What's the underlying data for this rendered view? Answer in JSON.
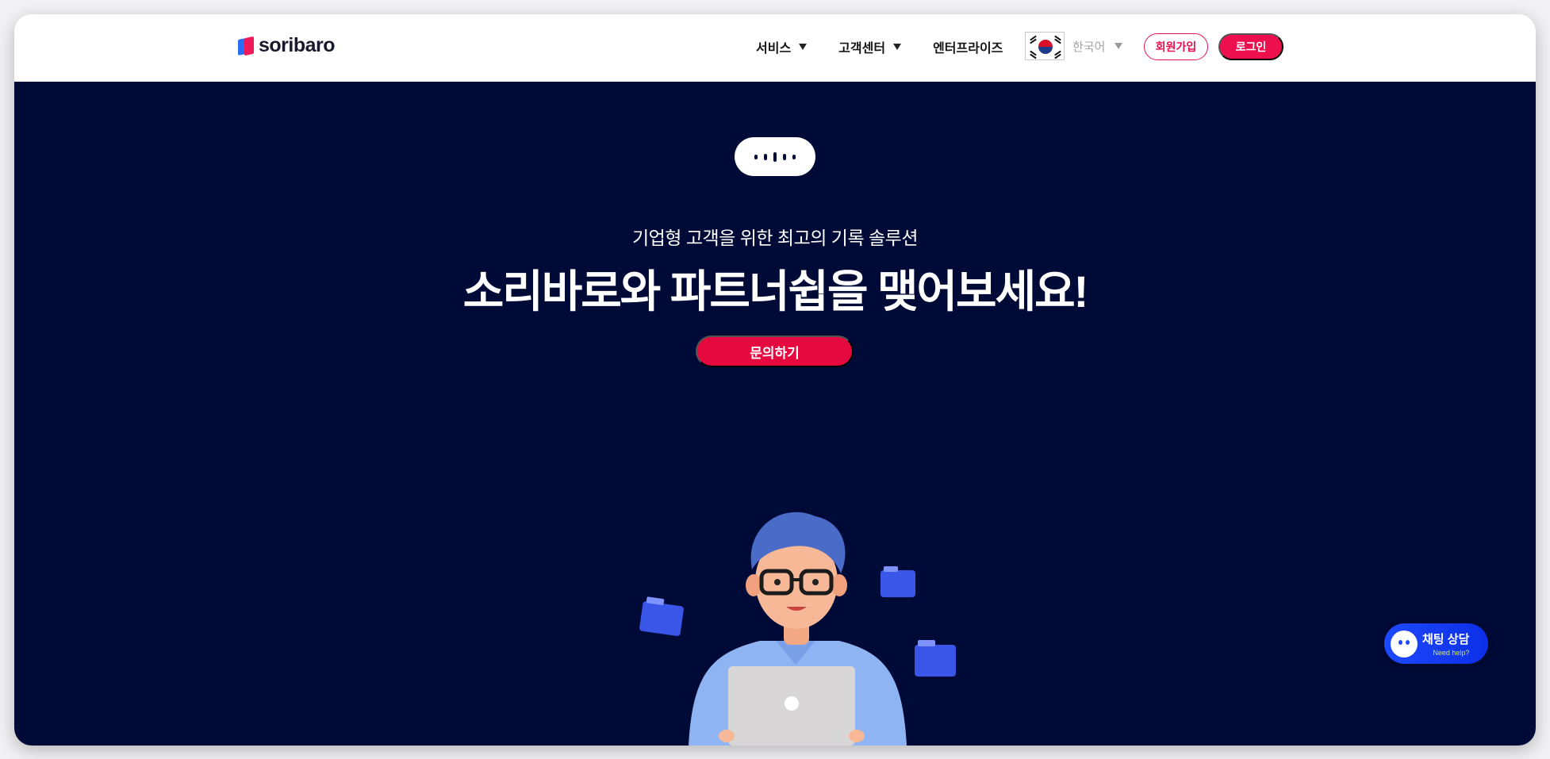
{
  "header": {
    "logo_text": "soribaro",
    "nav": [
      {
        "label": "서비스",
        "has_caret": true
      },
      {
        "label": "고객센터",
        "has_caret": true
      },
      {
        "label": "엔터프라이즈",
        "has_caret": false
      }
    ],
    "language": {
      "flag": "kr-flag-icon",
      "label": "한국어"
    },
    "signup_label": "회원가입",
    "login_label": "로그인"
  },
  "hero": {
    "subtitle": "기업형 고객을 위한 최고의 기록 솔루션",
    "headline": "소리바로와 파트너쉽을 맺어보세요!",
    "cta_label": "문의하기"
  },
  "chat_widget": {
    "title": "채팅 상담",
    "subtitle": "Need help?"
  },
  "colors": {
    "brand_pink": "#ee0f4f",
    "hero_bg": "#000a37",
    "chat_blue": "#1f49ff"
  }
}
